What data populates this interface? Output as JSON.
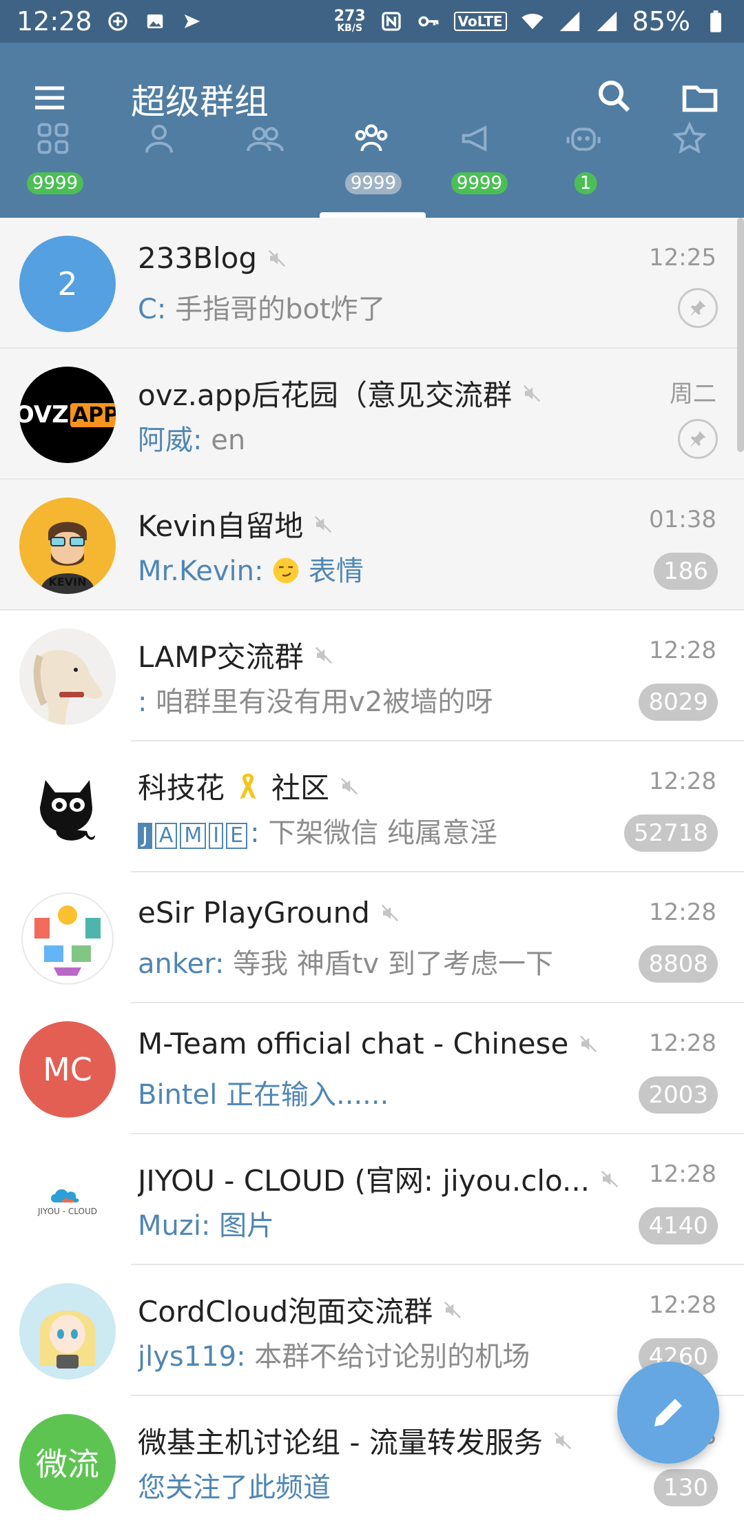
{
  "status_bar": {
    "time": "12:28",
    "speed_value": "273",
    "speed_unit": "KB/S",
    "volte": "VoLTE",
    "battery": "85%"
  },
  "app_bar": {
    "title": "超级群组"
  },
  "tabs": [
    {
      "name": "all",
      "badge": "9999"
    },
    {
      "name": "users",
      "badge": ""
    },
    {
      "name": "groups",
      "badge": ""
    },
    {
      "name": "supergroups",
      "badge": "9999"
    },
    {
      "name": "channels",
      "badge": "9999"
    },
    {
      "name": "bots",
      "badge": "1"
    },
    {
      "name": "favorites",
      "badge": ""
    }
  ],
  "chats": [
    {
      "title": "233Blog",
      "time": "12:25",
      "sender": "C:",
      "message": "手指哥的bot炸了",
      "pinned": true,
      "avatar_text": "2",
      "avatar_color": "#54a0e0"
    },
    {
      "title": "ovz.app后花园（意见交流群",
      "time": "周二",
      "sender": "阿威:",
      "message": "en",
      "pinned": true,
      "avatar_text": "OVZ",
      "avatar_text2": "APP"
    },
    {
      "title": "Kevin自留地",
      "time": "01:38",
      "sender": "Mr.Kevin:",
      "message": "表情",
      "count": "186",
      "avatar_text": "KEVIN"
    },
    {
      "title": "LAMP交流群",
      "time": "12:28",
      "sender": ":",
      "message": "咱群里有没有用v2被墙的呀",
      "count": "8029"
    },
    {
      "title": "科技花",
      "title_suffix": "社区",
      "time": "12:28",
      "sender_boxes": [
        "J",
        "A",
        "M",
        "I",
        "E"
      ],
      "sender": ":",
      "message": "下架微信 纯属意淫",
      "count": "52718"
    },
    {
      "title": "eSir PlayGround",
      "time": "12:28",
      "sender": "anker:",
      "message": "等我 神盾tv 到了考虑一下",
      "count": "8808"
    },
    {
      "title": "M-Team official chat - Chinese",
      "time": "12:28",
      "typing": "Bintel 正在输入......",
      "count": "2003",
      "avatar_text": "MC",
      "avatar_color": "#e35f54"
    },
    {
      "title": "JIYOU - CLOUD (官网: jiyou.clo...",
      "time": "12:28",
      "sender": "Muzi:",
      "message": "图片",
      "message_is_media": true,
      "count": "4140",
      "avatar_text": "JIYOU - CLOUD"
    },
    {
      "title": "CordCloud泡面交流群",
      "time": "12:28",
      "sender": "jlys119:",
      "message": "本群不给讨论别的机场",
      "count": "4260"
    },
    {
      "title": "微基主机讨论组 - 流量转发服务",
      "time": "18",
      "sender": "",
      "message": "您关注了此频道",
      "message_is_media": true,
      "count": "130",
      "avatar_text": "微流",
      "avatar_color": "#5dc452"
    }
  ],
  "icons": {
    "menu": "menu-icon",
    "search": "search-icon",
    "folder": "folder-icon",
    "compose": "pencil-icon",
    "mute": "mute-icon",
    "pin": "pin-icon"
  },
  "colors": {
    "app_bar": "#517da2",
    "status_bar": "#3f6384",
    "accent": "#4f86b4",
    "badge_green": "#4cbe56",
    "fab": "#64a7e3"
  }
}
